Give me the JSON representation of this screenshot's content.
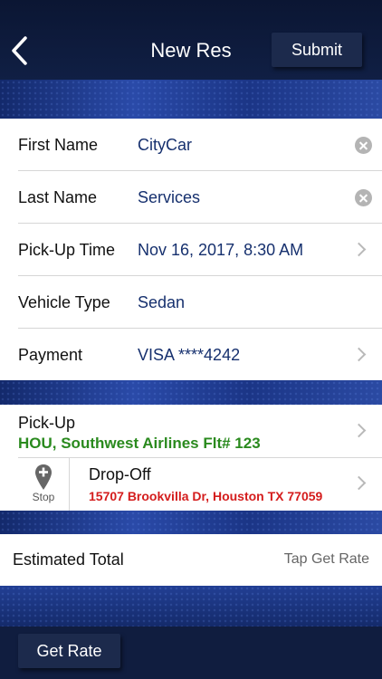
{
  "header": {
    "title": "New Res",
    "submit_label": "Submit"
  },
  "form": {
    "first_name": {
      "label": "First Name",
      "value": "CityCar"
    },
    "last_name": {
      "label": "Last Name",
      "value": "Services"
    },
    "pickup_time": {
      "label": "Pick-Up Time",
      "value": "Nov 16, 2017, 8:30 AM"
    },
    "vehicle_type": {
      "label": "Vehicle Type",
      "value": "Sedan"
    },
    "payment": {
      "label": "Payment",
      "value": "VISA ****4242"
    }
  },
  "locations": {
    "pickup": {
      "label": "Pick-Up",
      "value": "HOU, Southwest Airlines Flt# 123"
    },
    "stop_label": "Stop",
    "dropoff": {
      "label": "Drop-Off",
      "value": "15707 Brookvilla Dr, Houston TX 77059"
    }
  },
  "total": {
    "label": "Estimated Total",
    "value": "Tap Get Rate"
  },
  "footer": {
    "get_rate_label": "Get Rate"
  },
  "colors": {
    "value_blue": "#16306e",
    "pickup_green": "#2a8a1e",
    "dropoff_red": "#d41c1c",
    "header_bg": "#0b1633"
  },
  "icons": [
    "back-arrow-icon",
    "clear-icon",
    "chevron-right-icon",
    "map-pin-plus-icon"
  ]
}
